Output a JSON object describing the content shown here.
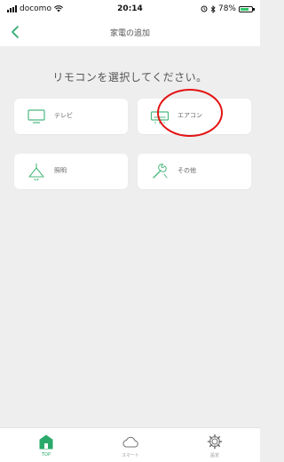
{
  "status_bar": {
    "carrier": "docomo",
    "time": "20:14",
    "battery": "78%",
    "battery_level": 0.78
  },
  "nav": {
    "back_icon": "chevron-left-icon",
    "title": "家電の追加"
  },
  "instruction": "リモコンを選択してください。",
  "remotes": [
    {
      "label": "テレビ",
      "icon": "tv-icon"
    },
    {
      "label": "エアコン",
      "icon": "air-conditioner-icon"
    },
    {
      "label": "照明",
      "icon": "ceiling-light-icon"
    },
    {
      "label": "その他",
      "icon": "wrench-icon"
    }
  ],
  "annotation": {
    "highlight_color": "#e31313",
    "highlighted_item": "エアコン"
  },
  "tabs": [
    {
      "label": "TOP",
      "icon": "home-icon",
      "active": true
    },
    {
      "label": "スマート",
      "icon": "cloud-icon",
      "active": false
    },
    {
      "label": "設定",
      "icon": "gear-icon",
      "active": false
    }
  ],
  "colors": {
    "accent": "#2aa96a",
    "icon": "#4db87f",
    "background": "#eeeeee"
  }
}
